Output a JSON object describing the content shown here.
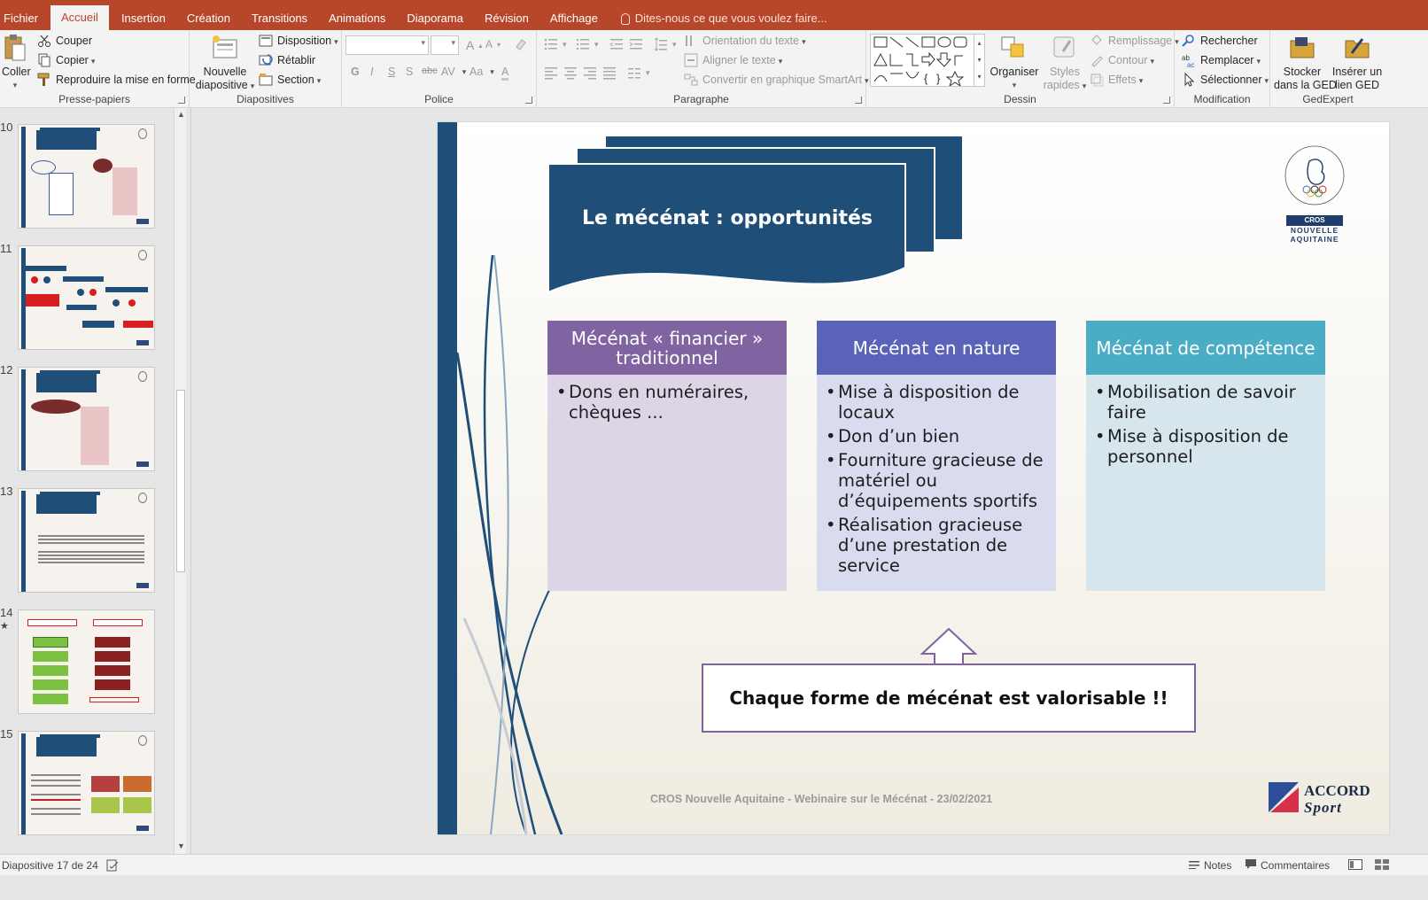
{
  "tabs": [
    {
      "label": "Fichier",
      "active": false
    },
    {
      "label": "Accueil",
      "active": true
    },
    {
      "label": "Insertion",
      "active": false
    },
    {
      "label": "Création",
      "active": false
    },
    {
      "label": "Transitions",
      "active": false
    },
    {
      "label": "Animations",
      "active": false
    },
    {
      "label": "Diaporama",
      "active": false
    },
    {
      "label": "Révision",
      "active": false
    },
    {
      "label": "Affichage",
      "active": false
    }
  ],
  "tell_me": "Dites-nous ce que vous voulez faire...",
  "ribbon": {
    "clipboard": {
      "label": "Presse-papiers",
      "paste": "Coller",
      "cut": "Couper",
      "copy": "Copier",
      "format_painter": "Reproduire la mise en forme"
    },
    "slides": {
      "label": "Diapositives",
      "new_line1": "Nouvelle",
      "new_line2": "diapositive",
      "layout": "Disposition",
      "reset": "Rétablir",
      "section": "Section"
    },
    "font": {
      "label": "Police",
      "bold": "G",
      "italic": "I",
      "underline": "S",
      "shadow": "S",
      "strike": "abc",
      "spacing": "AV",
      "case": "Aa"
    },
    "paragraph": {
      "label": "Paragraphe",
      "text_direction": "Orientation du texte",
      "align_text": "Aligner le texte",
      "smartart": "Convertir en graphique SmartArt"
    },
    "drawing": {
      "label": "Dessin",
      "arrange": "Organiser",
      "quick_styles_line1": "Styles",
      "quick_styles_line2": "rapides",
      "fill": "Remplissage",
      "outline": "Contour",
      "effects": "Effets"
    },
    "editing": {
      "label": "Modification",
      "find": "Rechercher",
      "replace": "Remplacer",
      "select": "Sélectionner"
    },
    "gedexpert": {
      "label": "GedExpert",
      "store_line1": "Stocker",
      "store_line2": "dans la GED",
      "insert_line1": "Insérer un",
      "insert_line2": "lien GED"
    }
  },
  "thumbnails": [
    {
      "number": "10",
      "star": ""
    },
    {
      "number": "11",
      "star": ""
    },
    {
      "number": "12",
      "star": ""
    },
    {
      "number": "13",
      "star": ""
    },
    {
      "number": "14",
      "star": "★"
    },
    {
      "number": "15",
      "star": ""
    }
  ],
  "slide": {
    "title": "Le mécénat : opportunités",
    "columns": [
      {
        "header": "Mécénat « financier » traditionnel",
        "color": "#8064a2",
        "body_color": "#ddd5e6",
        "items": [
          "Dons en numéraires, chèques ..."
        ]
      },
      {
        "header": "Mécénat en nature",
        "color": "#5b63b8",
        "body_color": "#d9dbee",
        "items": [
          "Mise à disposition de locaux",
          "Don d’un bien",
          " Fourniture gracieuse de matériel ou d’équipements sportifs",
          "Réalisation gracieuse d’une prestation de service"
        ]
      },
      {
        "header": "Mécénat de compétence",
        "color": "#4bacc6",
        "body_color": "#d6e6ec",
        "items": [
          "Mobilisation de savoir faire",
          " Mise à disposition de personnel"
        ]
      }
    ],
    "callout": "Chaque forme de mécénat est valorisable !!",
    "footer": "CROS Nouvelle Aquitaine - Webinaire sur le Mécénat - 23/02/2021",
    "logo_cros": {
      "badge": "CROS",
      "line1": "NOUVELLE",
      "line2": "AQUITAINE"
    },
    "logo_accord": {
      "word1": "ACCORD",
      "word2": "Sport"
    }
  },
  "status": {
    "slide_indicator": "Diapositive 17 de 24",
    "notes": "Notes",
    "comments": "Commentaires"
  },
  "colors": {
    "accent": "#b7472a",
    "title_blue": "#1f4e79"
  }
}
